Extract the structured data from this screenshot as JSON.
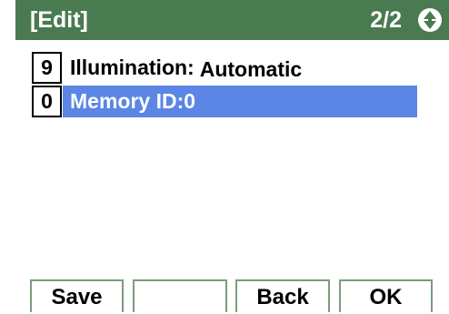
{
  "header": {
    "title": "[Edit]",
    "page": "2/2",
    "nav_icon": "up-down-arrow-icon"
  },
  "items": [
    {
      "key": "9",
      "label": "Illumination:",
      "value": "Automatic",
      "selected": false
    },
    {
      "key": "0",
      "label": "Memory ID:0",
      "selected": true
    }
  ],
  "softkeys": [
    "Save",
    "",
    "Back",
    "OK"
  ],
  "colors": {
    "header": "#4a7a4f",
    "selection": "#5b86e5",
    "softkey_border": "#7a9c7d"
  }
}
